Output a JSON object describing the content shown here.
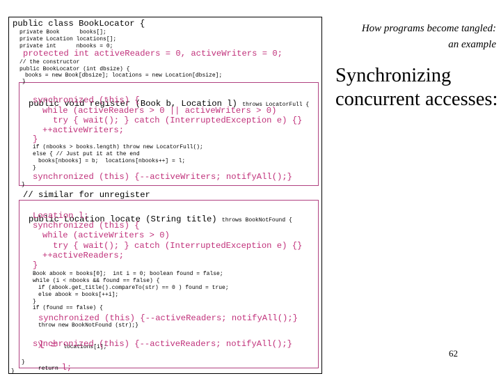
{
  "slide": {
    "subtitle_line1": "How programs become tangled:",
    "subtitle_line2": "an example",
    "title_line1": "Synchronizing",
    "title_line2": "concurrent accesses:",
    "page_number": "62"
  },
  "code": {
    "class_decl": "public class BookLocator {",
    "field1": "private Book      books[];",
    "field2": "private Location locations[];",
    "field3": "private int      nbooks = 0;",
    "protected_fields": "protected int activeReaders = 0, activeWriters = 0;",
    "ctor_comment": "// the constructor",
    "ctor_decl": "public BookLocator (int dbsize) {",
    "ctor_body": "books = new Book[dbsize]; locations = new Location[dbsize];",
    "ctor_close": "}",
    "register": {
      "decl_main": "public void register (Book b, Location l) ",
      "decl_throws": "throws LocatorFull {",
      "sync_open": "synchronized (this) {",
      "while": "while (activeReaders > 0 || activeWriters > 0)",
      "try": "try { wait(); } catch (InterruptedException e) {}",
      "inc": "++activeWriters;",
      "sync_close": "}",
      "if_full": "if (nbooks > books.length) throw new LocatorFull();",
      "else": "else { // Just put it at the end",
      "assign": "books[nbooks] = b;  locations[nbooks++] = l;",
      "else_close": "}",
      "sync_exit": "synchronized (this) {--activeWriters; notifyAll();}",
      "close": "}"
    },
    "unregister_comment": "// similar for unregister",
    "locate": {
      "decl_main": "public Location locate (String title) ",
      "decl_throws": "throws BookNotFound {",
      "local": "Location l;",
      "sync_open": "synchronized (this) {",
      "while": "while (activeWriters > 0)",
      "try": "try { wait(); } catch (InterruptedException e) {}",
      "inc": "++activeReaders;",
      "sync_close": "}",
      "vars": "Book abook = books[0];  int i = 0; boolean found = false;",
      "loop": "while (i < nbooks && found == false) {",
      "if_match": "if (abook.get_title().compareTo(str) == 0 ) found = true;",
      "else_next": "else abook = books[++i];",
      "loop_close": "}",
      "if_notfound": "if (found == false) {",
      "sync_exit1": "synchronized (this) {--activeReaders; notifyAll();}",
      "throw": "throw new BookNotFound (str);}",
      "assign_l_var": "l = ",
      "assign_l_val": "locations[i];",
      "sync_exit2": "synchronized (this) {--activeReaders; notifyAll();}",
      "return_kw": "return ",
      "return_val": "l;",
      "close": "}"
    },
    "class_close": "}"
  },
  "colors": {
    "accent_pink": "#c0307a",
    "box_border": "#b04080"
  }
}
